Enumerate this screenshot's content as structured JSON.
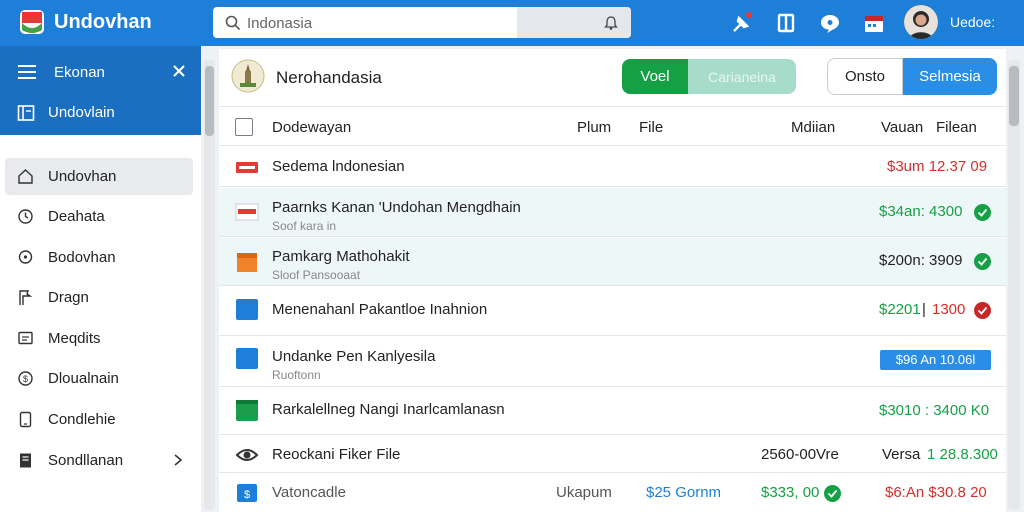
{
  "app": {
    "title": "Undovhan",
    "brand_color": "#1e7fd8"
  },
  "search": {
    "placeholder": "Indonasia"
  },
  "user": {
    "name": "Uedoe:"
  },
  "sidebar": {
    "header_label": "Ekonan",
    "sub_label": "Undovlain",
    "items": [
      {
        "label": "Undovhan",
        "icon": "home-icon"
      },
      {
        "label": "Deahata",
        "icon": "clock-icon"
      },
      {
        "label": "Bodovhan",
        "icon": "location-icon"
      },
      {
        "label": "Dragn",
        "icon": "flag-icon"
      },
      {
        "label": "Meqdits",
        "icon": "chat-icon"
      },
      {
        "label": "Dloualnain",
        "icon": "dollar-circle-icon"
      },
      {
        "label": "Condlehie",
        "icon": "phone-icon"
      },
      {
        "label": "Sondllanan",
        "icon": "document-icon"
      }
    ]
  },
  "panel": {
    "title": "Nerohandasia",
    "btn_voel": "Voel",
    "btn_carian": "Carianeina",
    "btn_onsto": "Onsto",
    "btn_selmesia": "Selmesia"
  },
  "columns": {
    "name": "Dodewayan",
    "plum": "Plum",
    "file": "File",
    "median": "Mdiian",
    "value": "Vauan",
    "filecol": "Filean"
  },
  "rows": [
    {
      "title": "Sedema lndonesian",
      "sub": "",
      "value": "$3um 12.37 09"
    },
    {
      "title": "Paarnks Kanan 'Undohan Mengdhain",
      "sub": "Soof kara in",
      "value": "$34an: 4300"
    },
    {
      "title": "Pamkarg Mathohakit",
      "sub": "Sloof Pansooaat",
      "value": "$200n: 3909"
    },
    {
      "title": "Menenahanl Pakantloe Inahnion",
      "sub": "",
      "value_a": "$2201",
      "value_b": "1300"
    },
    {
      "title": "Undanke Pen Kanlyesila",
      "sub": "Ruoftonn",
      "value": "$96 An 10.06l"
    },
    {
      "title": "Rarkalellneg Nangi Inarlcamlanasn",
      "sub": "",
      "value": "$3010 : 3400 K0"
    },
    {
      "title": "Reockani Fiker File",
      "sub": "",
      "value_mid": "2560-00Vre",
      "value_a": "Versa",
      "value_b": "1 28.8.300"
    },
    {
      "title": "Vatoncadle",
      "sub": "",
      "plum": "Ukapum",
      "file": "$25 Gornm",
      "median": "$333, 00",
      "value": "$6:An $30.8 20"
    }
  ],
  "colors": {
    "green": "#16a046",
    "red": "#d32f2f",
    "blue": "#1e7fd8"
  }
}
